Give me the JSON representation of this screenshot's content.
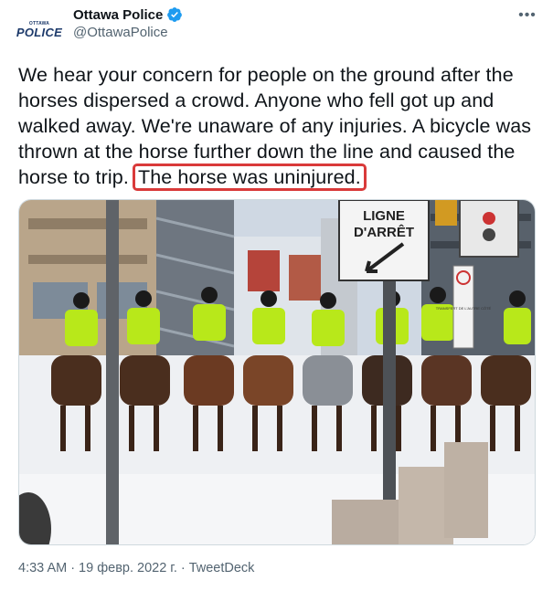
{
  "account": {
    "display_name": "Ottawa Police",
    "handle": "@OttawaPolice",
    "avatar_logo_small": "OTTAWA",
    "avatar_logo_big": "POLICE",
    "verified": true
  },
  "menu": {
    "more_icon": "ellipsis-icon",
    "more_label": "•••"
  },
  "tweet": {
    "text_main": "We hear your concern for people on the ground after the horses dispersed a crowd. Anyone who fell got up and walked away. We're unaware of any injuries. A bicycle was thrown at the horse further down the line and caused the horse to trip.",
    "text_highlight": "The horse was uninjured.",
    "highlight_color": "#d93a3a"
  },
  "photo": {
    "sign_line1": "LIGNE",
    "sign_line2": "D'ARRÊT",
    "small_sign_text": "TRANSFERT DE L'AUTRE CÔTÉ"
  },
  "meta": {
    "time": "4:33 AM",
    "separator": "·",
    "date": "19 февр. 2022 г.",
    "source": "TweetDeck"
  }
}
